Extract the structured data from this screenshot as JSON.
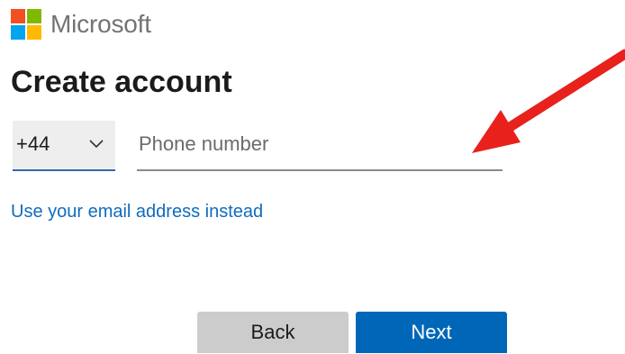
{
  "brand": {
    "name": "Microsoft",
    "logo_colors": [
      "#f25022",
      "#7fba00",
      "#00a4ef",
      "#ffb900"
    ]
  },
  "title": "Create account",
  "phone": {
    "country_code": "+44",
    "dropdown_icon": "chevron-down-icon",
    "placeholder": "Phone number",
    "value": ""
  },
  "email_link": "Use your email address instead",
  "buttons": {
    "back": "Back",
    "next": "Next"
  },
  "colors": {
    "accent": "#0067b8",
    "link": "#0f6cbd",
    "annotation_arrow": "#e8211c"
  }
}
